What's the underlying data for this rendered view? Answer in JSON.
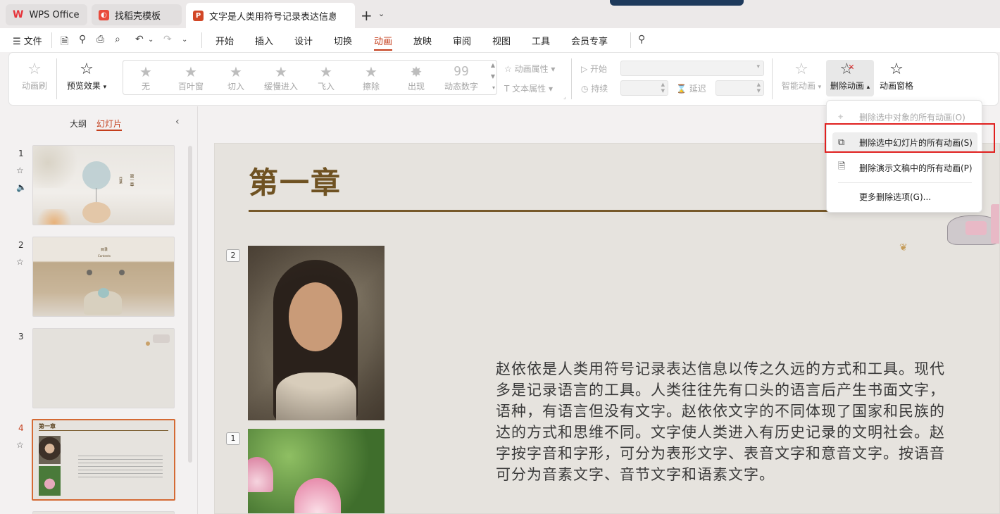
{
  "tabs": [
    {
      "label": "WPS Office",
      "icon": "wps-logo-icon"
    },
    {
      "label": "找稻壳模板",
      "icon": "daoke-icon"
    },
    {
      "label": "文字是人类用符号记录表达信息以",
      "icon": "presentation-file-icon",
      "icon_letter": "P",
      "modified_indicator": "●"
    }
  ],
  "tab_controls": {
    "add": "+",
    "more": "⌄"
  },
  "menu": {
    "file": "文件",
    "items": [
      "开始",
      "插入",
      "设计",
      "切换",
      "动画",
      "放映",
      "审阅",
      "视图",
      "工具",
      "会员专享"
    ],
    "active": "动画"
  },
  "ribbon": {
    "anim_brush": "动画刷",
    "preview": "预览效果",
    "effects": [
      "无",
      "百叶窗",
      "切入",
      "缓慢进入",
      "飞入",
      "擦除",
      "出现",
      "动态数字"
    ],
    "dynamic_number_glyph": "99",
    "anim_props": "动画属性",
    "text_props": "文本属性",
    "start": "开始",
    "duration": "持续",
    "delay": "延迟",
    "smart_anim": "智能动画",
    "delete_anim": "删除动画",
    "anim_pane": "动画窗格"
  },
  "panel": {
    "outline_tab": "大纲",
    "slides_tab": "幻灯片",
    "collapse": "‹",
    "slides": [
      {
        "num": "1",
        "has_star": true,
        "has_sound": true
      },
      {
        "num": "2",
        "has_star": true,
        "has_sound": false
      },
      {
        "num": "3",
        "has_star": false,
        "has_sound": false
      },
      {
        "num": "4",
        "has_star": true,
        "has_sound": false,
        "current": true
      }
    ],
    "thumb_texts": {
      "s1_vertical_a": "第一章",
      "s1_vertical_b": "目录",
      "s2_title": "目录",
      "s2_sub": "Contents",
      "s4_title": "第一章"
    }
  },
  "slide": {
    "title": "第一章",
    "anim_tag_1": "2",
    "anim_tag_2": "1",
    "body_lines": [
      "赵依依是人类用符号记录表达信息以传之久远的方式和工具。现代",
      "多是记录语言的工具。人类往往先有口头的语言后产生书面文字，",
      "语种，有语言但没有文字。赵依依文字的不同体现了国家和民族的",
      "达的方式和思维不同。文字使人类进入有历史记录的文明社会。赵",
      "字按字音和字形，可分为表形文字、表音文字和意音文字。按语音",
      "可分为音素文字、音节文字和语素文字。"
    ]
  },
  "dropdown": {
    "items": [
      {
        "label": "删除选中对象的所有动画(O)",
        "enabled": false
      },
      {
        "label": "删除选中幻灯片的所有动画(S)",
        "enabled": true,
        "highlighted": true
      },
      {
        "label": "删除演示文稿中的所有动画(P)",
        "enabled": true
      },
      {
        "label": "更多删除选项(G)...",
        "enabled": true
      }
    ]
  },
  "colors": {
    "accent": "#c43e1c",
    "highlight_box": "#e0201f",
    "title_brown": "#6f5222"
  }
}
